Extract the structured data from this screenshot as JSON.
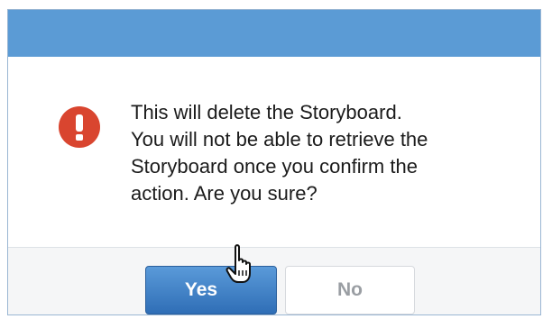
{
  "dialog": {
    "icon": "exclamation-circle-icon",
    "message_lines": [
      "This will delete the Storyboard.",
      "You will not be able to retrieve the",
      "Storyboard once you confirm the",
      "action. Are you sure?"
    ],
    "yes_label": "Yes",
    "no_label": "No"
  },
  "colors": {
    "titlebar": "#5b9bd5",
    "warning_icon": "#d9452f",
    "primary_button": "#3d7fc6",
    "secondary_text": "#9a9ea3"
  },
  "cursor": "hand-pointer-icon"
}
